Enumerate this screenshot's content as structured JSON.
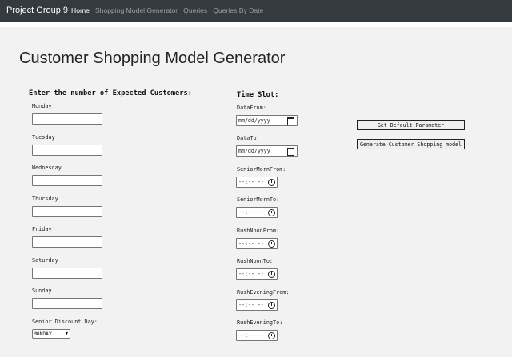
{
  "navbar": {
    "brand": "Project Group 9",
    "links": [
      "Home",
      "Shopping Model Generator",
      "Queries",
      "Queries By Date"
    ]
  },
  "page": {
    "title": "Customer Shopping Model Generator"
  },
  "customers": {
    "heading": "Enter the number of Expected Customers:",
    "days": [
      "Monday",
      "Tuesday",
      "Wednesday",
      "Thursday",
      "Friday",
      "Saturday",
      "Sunday"
    ],
    "senior_discount_label": "Senior Discount Day:",
    "senior_discount_value": "MONDAY"
  },
  "timeslot": {
    "heading": "Time Slot:",
    "date_fields": [
      {
        "label": "DataFrom:",
        "placeholder": "mm/dd/yyyy"
      },
      {
        "label": "DataTo:",
        "placeholder": "mm/dd/yyyy"
      }
    ],
    "time_fields": [
      {
        "label": "SeniorMornFrom:",
        "placeholder": "--:-- --"
      },
      {
        "label": "SeniorMornTo:",
        "placeholder": "--:-- --"
      },
      {
        "label": "RushNoonFrom:",
        "placeholder": "--:-- --"
      },
      {
        "label": "RushNoonTo:",
        "placeholder": "--:-- --"
      },
      {
        "label": "RushEveningFrom:",
        "placeholder": "--:-- --"
      },
      {
        "label": "RushEveningTo:",
        "placeholder": "--:-- --"
      }
    ]
  },
  "actions": {
    "default_button": "Get Default Parameter",
    "generate_button": "Generate Customer Shopping model"
  }
}
